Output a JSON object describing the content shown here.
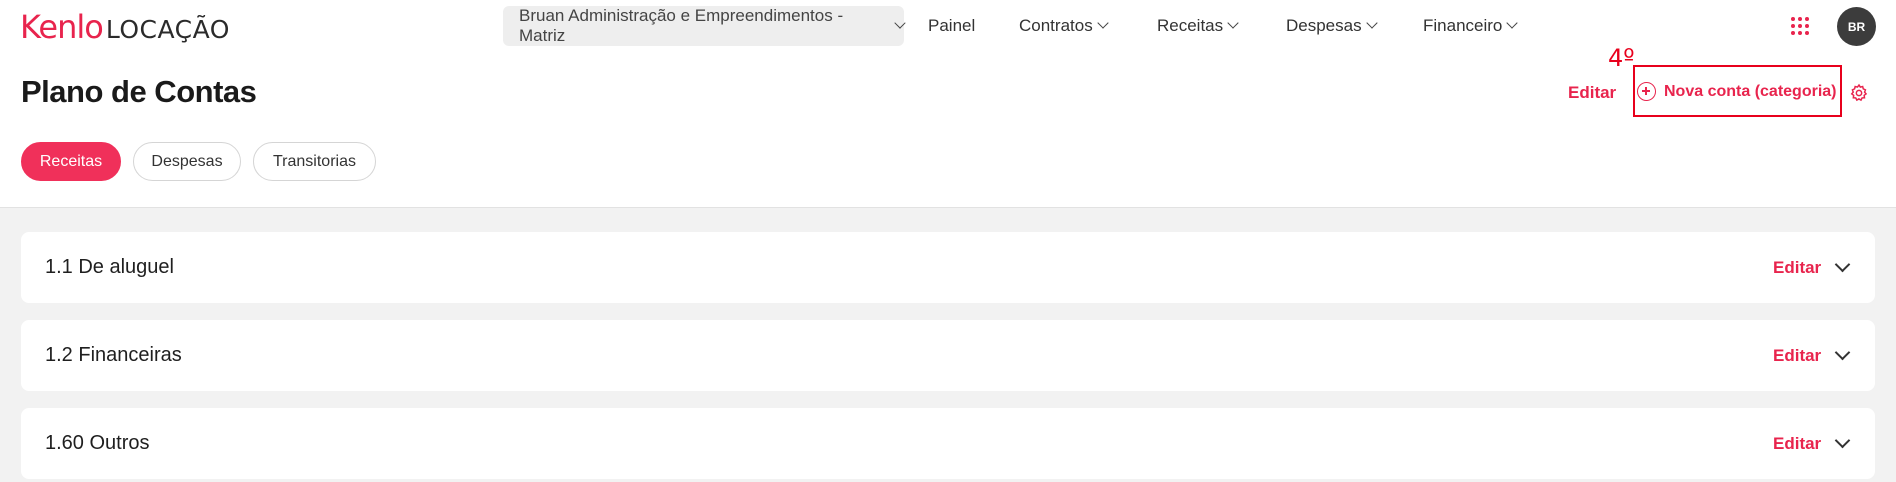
{
  "logo": {
    "brand": "Kenlo",
    "product": "LOCAÇÃO"
  },
  "header": {
    "company": "Bruan Administração e Empreendimentos - Matriz",
    "nav": [
      "Painel",
      "Contratos",
      "Receitas",
      "Despesas",
      "Financeiro"
    ],
    "user_initials": "BR"
  },
  "page": {
    "title": "Plano de Contas",
    "edit_label": "Editar",
    "annotation": "4º",
    "new_account_label": "Nova conta (categoria)"
  },
  "tabs": [
    "Receitas",
    "Despesas",
    "Transitorias"
  ],
  "active_tab": "Receitas",
  "accounts": [
    {
      "name": "1.1 De aluguel",
      "edit": "Editar"
    },
    {
      "name": "1.2 Financeiras",
      "edit": "Editar"
    },
    {
      "name": "1.60 Outros",
      "edit": "Editar"
    }
  ],
  "colors": {
    "accent": "#e8244d",
    "annotation": "#e8001c",
    "background": "#f2f2f2"
  },
  "icons": [
    "chevron-down-icon",
    "apps-grid-icon",
    "plus-circle-icon",
    "gear-icon"
  ]
}
